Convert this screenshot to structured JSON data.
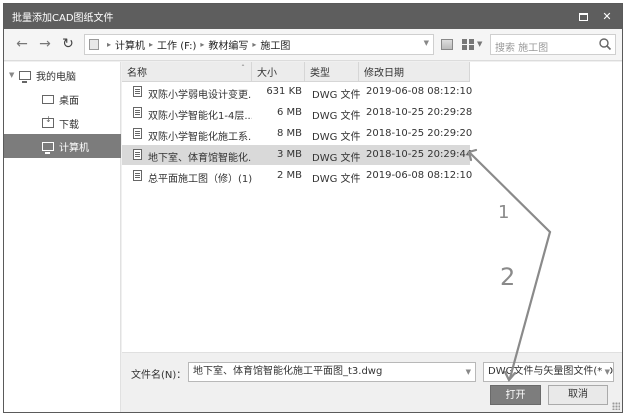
{
  "window": {
    "title": "批量添加CAD图纸文件"
  },
  "address": {
    "crumbs": [
      "计算机",
      "工作 (F:)",
      "教材编写",
      "施工图"
    ],
    "search_placeholder": "搜索 施工图"
  },
  "sidebar": {
    "items": [
      {
        "label": "我的电脑",
        "icon": "computer-icon"
      },
      {
        "label": "桌面",
        "icon": "desktop-icon"
      },
      {
        "label": "下载",
        "icon": "download-icon"
      },
      {
        "label": "计算机",
        "icon": "computer-icon",
        "selected": true
      }
    ]
  },
  "columns": {
    "name": "名称",
    "size": "大小",
    "type": "类型",
    "modified": "修改日期"
  },
  "files": [
    {
      "name": "双陈小学弱电设计变更...",
      "size": "631 KB",
      "type": "DWG 文件",
      "modified": "2019-06-08 08:12:10"
    },
    {
      "name": "双陈小学智能化1-4层...",
      "size": "6 MB",
      "type": "DWG 文件",
      "modified": "2018-10-25 20:29:28"
    },
    {
      "name": "双陈小学智能化施工系...",
      "size": "8 MB",
      "type": "DWG 文件",
      "modified": "2018-10-25 20:29:20"
    },
    {
      "name": "地下室、体育馆智能化...",
      "size": "3 MB",
      "type": "DWG 文件",
      "modified": "2018-10-25 20:29:44",
      "selected": true
    },
    {
      "name": "总平面施工图（修）(1)...",
      "size": "2 MB",
      "type": "DWG 文件",
      "modified": "2019-06-08 08:12:10"
    }
  ],
  "bottom": {
    "filename_label": "文件名(N)：",
    "filename_value": "地下室、体育馆智能化施工平面图_t3.dwg",
    "filetype_value": "DWG文件与矢量图文件(*.D",
    "open_label": "打开",
    "cancel_label": "取消"
  },
  "annotations": {
    "step1": "1",
    "step2": "2",
    "color": "#8a8a8a"
  },
  "colors": {
    "titlebar": "#5e5e5e",
    "selection": "#7c7c7c",
    "row_selected": "#d9d9d9"
  }
}
